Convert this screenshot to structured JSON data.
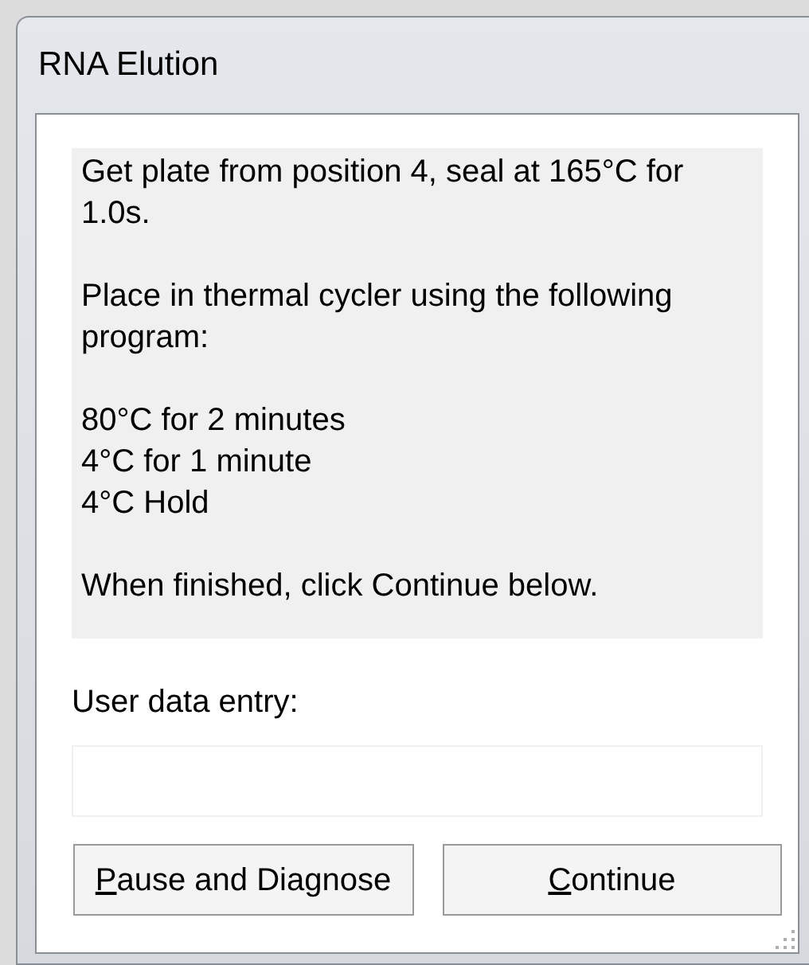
{
  "window": {
    "title": "RNA Elution"
  },
  "instructions": [
    {
      "lines": [
        "Get plate from position 4, seal at 165°C for 1.0s."
      ]
    },
    {
      "lines": [
        "Place in thermal cycler using the following program:"
      ]
    },
    {
      "lines": [
        "80°C for 2 minutes",
        "4°C for 1 minute",
        "4°C Hold"
      ]
    },
    {
      "lines": [
        "When finished, click Continue below."
      ]
    }
  ],
  "entry": {
    "label": "User data entry:"
  },
  "buttons": [
    {
      "label": "Pause and Diagnose"
    },
    {
      "label": "Continue"
    }
  ]
}
